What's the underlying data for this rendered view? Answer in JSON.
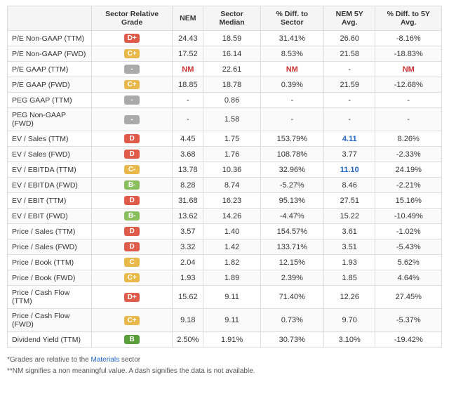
{
  "table": {
    "headers": [
      "",
      "Sector Relative Grade",
      "NEM",
      "Sector Median",
      "% Diff. to Sector",
      "NEM 5Y Avg.",
      "% Diff. to 5Y Avg."
    ],
    "rows": [
      {
        "label": "P/E Non-GAAP (TTM)",
        "grade": "D+",
        "grade_class": "grade-d-plus",
        "nem": "24.43",
        "sector_median": "18.59",
        "pct_diff_sector": "31.41%",
        "nem_5y": "26.60",
        "pct_diff_5y": "-8.16%"
      },
      {
        "label": "P/E Non-GAAP (FWD)",
        "grade": "C+",
        "grade_class": "grade-c-plus",
        "nem": "17.52",
        "sector_median": "16.14",
        "pct_diff_sector": "8.53%",
        "nem_5y": "21.58",
        "pct_diff_5y": "-18.83%"
      },
      {
        "label": "P/E GAAP (TTM)",
        "grade": "-",
        "grade_class": "grade-dash",
        "nem": "NM",
        "nem_is_nm": true,
        "sector_median": "22.61",
        "pct_diff_sector": "NM",
        "pct_diff_sector_nm": true,
        "nem_5y": "-",
        "pct_diff_5y": "NM",
        "pct_diff_5y_nm": true
      },
      {
        "label": "P/E GAAP (FWD)",
        "grade": "C+",
        "grade_class": "grade-c-plus",
        "nem": "18.85",
        "sector_median": "18.78",
        "pct_diff_sector": "0.39%",
        "nem_5y": "21.59",
        "pct_diff_5y": "-12.68%"
      },
      {
        "label": "PEG GAAP (TTM)",
        "grade": "-",
        "grade_class": "grade-dash",
        "nem": "-",
        "sector_median": "0.86",
        "pct_diff_sector": "-",
        "nem_5y": "-",
        "pct_diff_5y": "-"
      },
      {
        "label": "PEG Non-GAAP (FWD)",
        "grade": "-",
        "grade_class": "grade-dash",
        "nem": "-",
        "sector_median": "1.58",
        "pct_diff_sector": "-",
        "nem_5y": "-",
        "pct_diff_5y": "-"
      },
      {
        "label": "EV / Sales (TTM)",
        "grade": "D",
        "grade_class": "grade-d",
        "nem": "4.45",
        "sector_median": "1.75",
        "pct_diff_sector": "153.79%",
        "nem_5y": "4.11",
        "pct_diff_5y": "8.26%",
        "nem_5y_highlight": true
      },
      {
        "label": "EV / Sales (FWD)",
        "grade": "D",
        "grade_class": "grade-d",
        "nem": "3.68",
        "sector_median": "1.76",
        "pct_diff_sector": "108.78%",
        "nem_5y": "3.77",
        "pct_diff_5y": "-2.33%"
      },
      {
        "label": "EV / EBITDA (TTM)",
        "grade": "C-",
        "grade_class": "grade-c-minus",
        "nem": "13.78",
        "sector_median": "10.36",
        "pct_diff_sector": "32.96%",
        "nem_5y": "11.10",
        "nem_5y_highlight": true,
        "pct_diff_5y": "24.19%"
      },
      {
        "label": "EV / EBITDA (FWD)",
        "grade": "B-",
        "grade_class": "grade-b-minus",
        "nem": "8.28",
        "sector_median": "8.74",
        "pct_diff_sector": "-5.27%",
        "nem_5y": "8.46",
        "pct_diff_5y": "-2.21%"
      },
      {
        "label": "EV / EBIT (TTM)",
        "grade": "D",
        "grade_class": "grade-d",
        "nem": "31.68",
        "sector_median": "16.23",
        "pct_diff_sector": "95.13%",
        "nem_5y": "27.51",
        "pct_diff_5y": "15.16%"
      },
      {
        "label": "EV / EBIT (FWD)",
        "grade": "B-",
        "grade_class": "grade-b-minus",
        "nem": "13.62",
        "sector_median": "14.26",
        "pct_diff_sector": "-4.47%",
        "nem_5y": "15.22",
        "pct_diff_5y": "-10.49%"
      },
      {
        "label": "Price / Sales (TTM)",
        "grade": "D",
        "grade_class": "grade-d",
        "nem": "3.57",
        "sector_median": "1.40",
        "pct_diff_sector": "154.57%",
        "nem_5y": "3.61",
        "pct_diff_5y": "-1.02%"
      },
      {
        "label": "Price / Sales (FWD)",
        "grade": "D",
        "grade_class": "grade-d",
        "nem": "3.32",
        "sector_median": "1.42",
        "pct_diff_sector": "133.71%",
        "nem_5y": "3.51",
        "pct_diff_5y": "-5.43%"
      },
      {
        "label": "Price / Book (TTM)",
        "grade": "C",
        "grade_class": "grade-c",
        "nem": "2.04",
        "sector_median": "1.82",
        "pct_diff_sector": "12.15%",
        "nem_5y": "1.93",
        "pct_diff_5y": "5.62%"
      },
      {
        "label": "Price / Book (FWD)",
        "grade": "C+",
        "grade_class": "grade-c-plus",
        "nem": "1.93",
        "sector_median": "1.89",
        "pct_diff_sector": "2.39%",
        "nem_5y": "1.85",
        "pct_diff_5y": "4.64%"
      },
      {
        "label": "Price / Cash Flow (TTM)",
        "grade": "D+",
        "grade_class": "grade-d-plus",
        "nem": "15.62",
        "sector_median": "9.11",
        "pct_diff_sector": "71.40%",
        "nem_5y": "12.26",
        "pct_diff_5y": "27.45%"
      },
      {
        "label": "Price / Cash Flow (FWD)",
        "grade": "C+",
        "grade_class": "grade-c-plus",
        "nem": "9.18",
        "sector_median": "9.11",
        "pct_diff_sector": "0.73%",
        "nem_5y": "9.70",
        "pct_diff_5y": "-5.37%"
      },
      {
        "label": "Dividend Yield (TTM)",
        "grade": "B",
        "grade_class": "grade-b",
        "nem": "2.50%",
        "sector_median": "1.91%",
        "pct_diff_sector": "30.73%",
        "nem_5y": "3.10%",
        "pct_diff_5y": "-19.42%"
      }
    ]
  },
  "footer": {
    "note1": "*Grades are relative to the ",
    "sector_link": "Materials",
    "note1_end": " sector",
    "note2": "**NM signifies a non meaningful value. A dash signifies the data is not available."
  }
}
